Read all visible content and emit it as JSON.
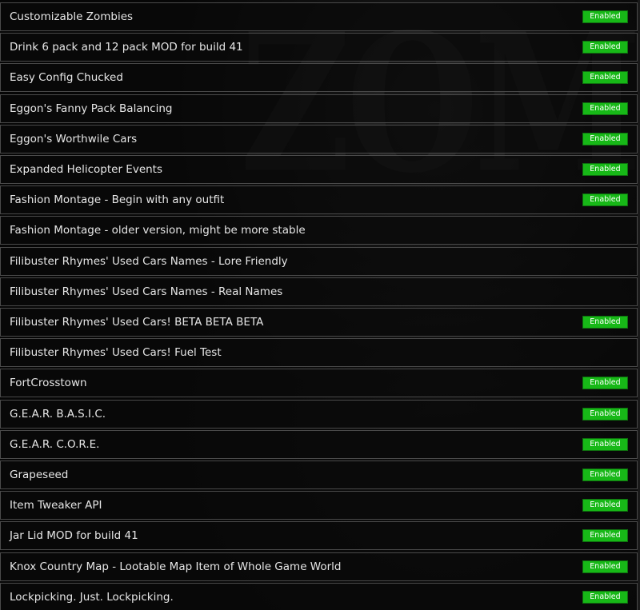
{
  "colors": {
    "enabled_badge": "#17b817",
    "row_border": "#4a4a4a",
    "text": "#e6e6e6"
  },
  "status_label": "Enabled",
  "mods": [
    {
      "name": "Customizable Zombies",
      "enabled": true
    },
    {
      "name": "Drink 6 pack and 12 pack MOD for build 41",
      "enabled": true
    },
    {
      "name": "Easy Config Chucked",
      "enabled": true
    },
    {
      "name": "Eggon's Fanny Pack Balancing",
      "enabled": true
    },
    {
      "name": "Eggon's Worthwile Cars",
      "enabled": true
    },
    {
      "name": "Expanded Helicopter Events",
      "enabled": true
    },
    {
      "name": "Fashion Montage - Begin with any outfit",
      "enabled": true
    },
    {
      "name": "Fashion Montage - older version, might be more stable",
      "enabled": false
    },
    {
      "name": "Filibuster Rhymes' Used Cars Names - Lore Friendly",
      "enabled": false
    },
    {
      "name": "Filibuster Rhymes' Used Cars Names - Real Names",
      "enabled": false
    },
    {
      "name": "Filibuster Rhymes' Used Cars! BETA BETA BETA",
      "enabled": true
    },
    {
      "name": "Filibuster Rhymes' Used Cars! Fuel Test",
      "enabled": false
    },
    {
      "name": "FortCrosstown",
      "enabled": true
    },
    {
      "name": "G.E.A.R. B.A.S.I.C.",
      "enabled": true
    },
    {
      "name": "G.E.A.R. C.O.R.E.",
      "enabled": true
    },
    {
      "name": "Grapeseed",
      "enabled": true
    },
    {
      "name": "Item Tweaker API",
      "enabled": true
    },
    {
      "name": "Jar Lid MOD for build 41",
      "enabled": true
    },
    {
      "name": "Knox Country Map - Lootable Map Item of Whole Game World",
      "enabled": true
    },
    {
      "name": "Lockpicking. Just. Lockpicking.",
      "enabled": true
    }
  ]
}
